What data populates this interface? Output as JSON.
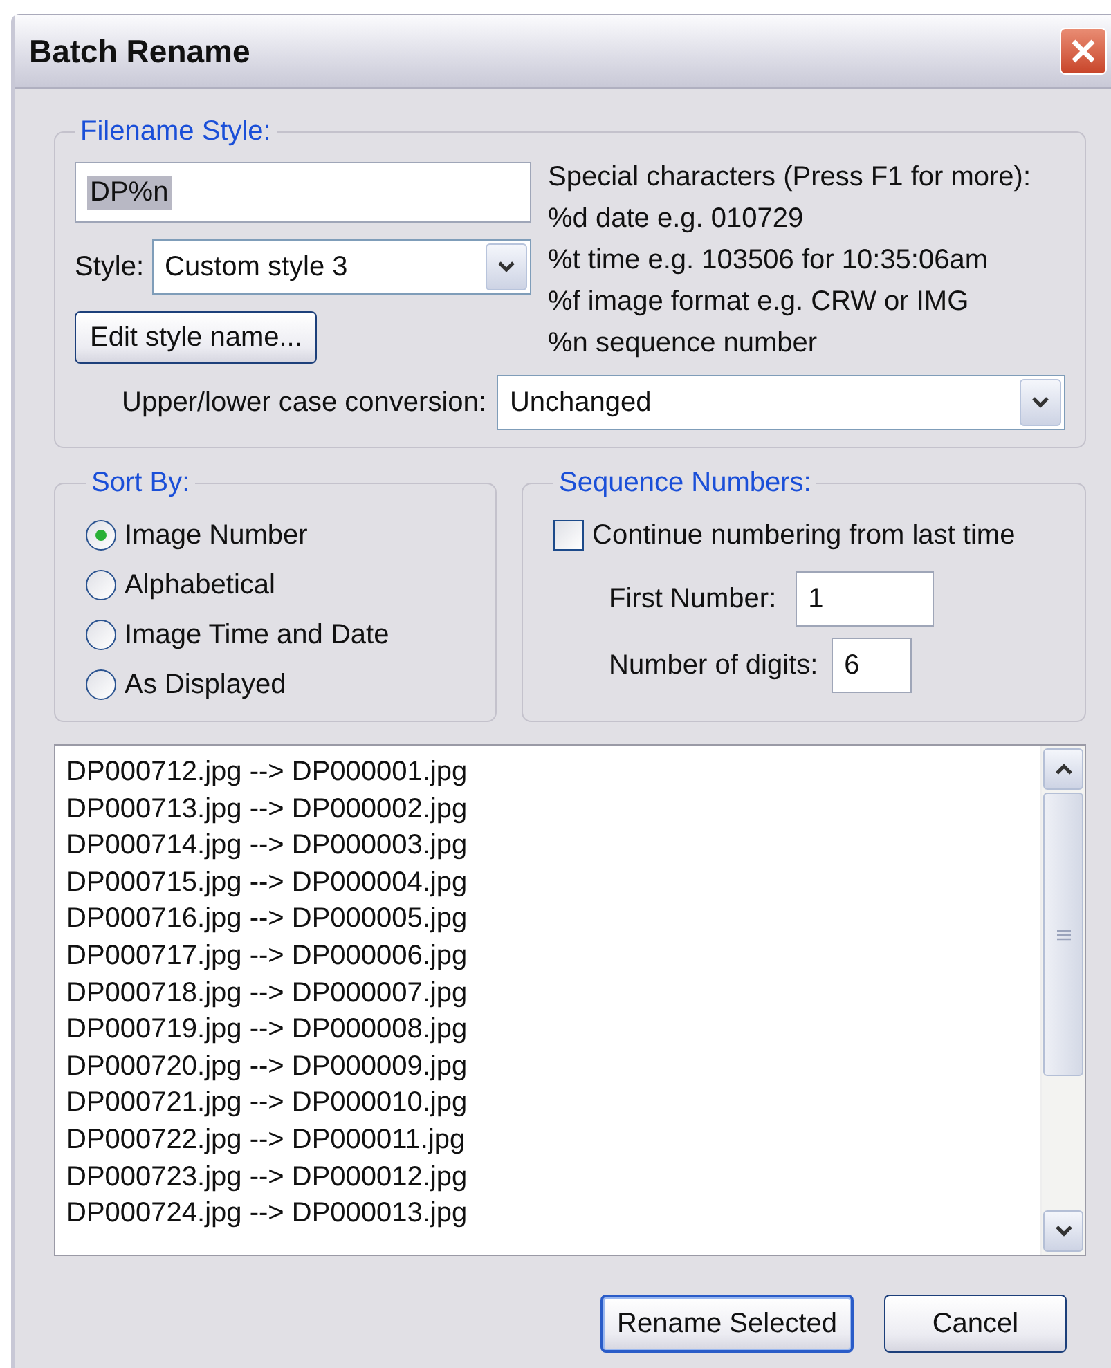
{
  "window": {
    "title": "Batch Rename"
  },
  "filename_style": {
    "title": "Filename Style:",
    "pattern": {
      "value": "DP%n",
      "selected": true
    },
    "style_label": "Style:",
    "style": {
      "value": "Custom style 3"
    },
    "edit_button": "Edit style name...",
    "help_lines": [
      "Special characters (Press F1 for more):",
      "%d date e.g. 010729",
      "%t time e.g. 103506 for 10:35:06am",
      "%f image format e.g. CRW or IMG",
      "%n sequence number"
    ],
    "case_label": "Upper/lower case conversion:",
    "case": {
      "value": "Unchanged"
    }
  },
  "sort_by": {
    "title": "Sort By:",
    "options": [
      {
        "label": "Image Number",
        "selected": true
      },
      {
        "label": "Alphabetical",
        "selected": false
      },
      {
        "label": "Image Time and Date",
        "selected": false
      },
      {
        "label": "As Displayed",
        "selected": false
      }
    ]
  },
  "sequence_numbers": {
    "title": "Sequence Numbers:",
    "continue": {
      "label": "Continue numbering from last time",
      "checked": false
    },
    "first_number": {
      "label": "First Number:",
      "value": "1"
    },
    "digits": {
      "label": "Number of digits:",
      "value": "6"
    }
  },
  "preview": {
    "rows": [
      "DP000712.jpg --> DP000001.jpg",
      "DP000713.jpg --> DP000002.jpg",
      "DP000714.jpg --> DP000003.jpg",
      "DP000715.jpg --> DP000004.jpg",
      "DP000716.jpg --> DP000005.jpg",
      "DP000717.jpg --> DP000006.jpg",
      "DP000718.jpg --> DP000007.jpg",
      "DP000719.jpg --> DP000008.jpg",
      "DP000720.jpg --> DP000009.jpg",
      "DP000721.jpg --> DP000010.jpg",
      "DP000722.jpg --> DP000011.jpg",
      "DP000723.jpg --> DP000012.jpg",
      "DP000724.jpg --> DP000013.jpg"
    ]
  },
  "buttons": [
    {
      "label": "Rename Selected",
      "default": true
    },
    {
      "label": "Cancel",
      "default": false
    }
  ]
}
